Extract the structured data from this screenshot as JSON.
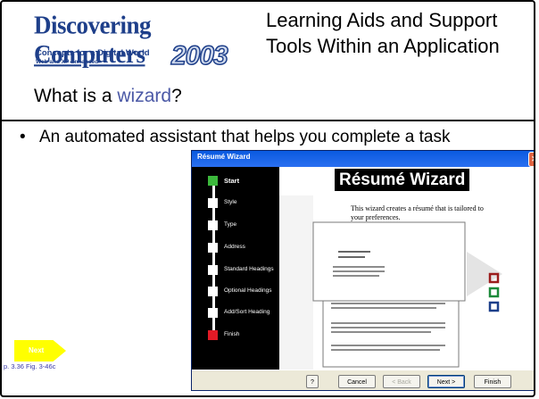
{
  "logo": {
    "line1a": "Discovering",
    "line1b": "Computers",
    "line2": "Concepts for a Digital World",
    "line3": "Web and XP Enhanced",
    "year": "2003"
  },
  "slide": {
    "title": "Learning Aids and Support Tools Within an Application",
    "subtitle_prefix": "What is a ",
    "subtitle_keyword": "wizard",
    "subtitle_suffix": "?",
    "bullet_marker": "•",
    "bullet": "An automated assistant that helps you complete a task"
  },
  "badge": {
    "label": "Next",
    "reference": "p. 3.36 Fig. 3-46c"
  },
  "wizard": {
    "window_title": "Résumé Wizard",
    "close_glyph": "✕",
    "heading": "Résumé Wizard",
    "description": "This wizard creates a résumé that is tailored to your preferences.",
    "steps": [
      {
        "label": "Start",
        "state": "current"
      },
      {
        "label": "Style",
        "state": "pending"
      },
      {
        "label": "Type",
        "state": "pending"
      },
      {
        "label": "Address",
        "state": "pending"
      },
      {
        "label": "Standard Headings",
        "state": "pending"
      },
      {
        "label": "Optional Headings",
        "state": "pending"
      },
      {
        "label": "Add/Sort Heading",
        "state": "pending"
      },
      {
        "label": "Finish",
        "state": "final"
      }
    ],
    "buttons": {
      "help": "?",
      "cancel": "Cancel",
      "back": "< Back",
      "next": "Next >",
      "finish": "Finish"
    },
    "swatch_colors": [
      "#9b1c1c",
      "#1c8a3a",
      "#1c3f8a"
    ]
  },
  "colors": {
    "accent_link": "#4b59a6",
    "titlebar": "#0a5ae0",
    "step_current": "#3cb83c",
    "step_final": "#e21a26",
    "badge": "#ffff00"
  }
}
